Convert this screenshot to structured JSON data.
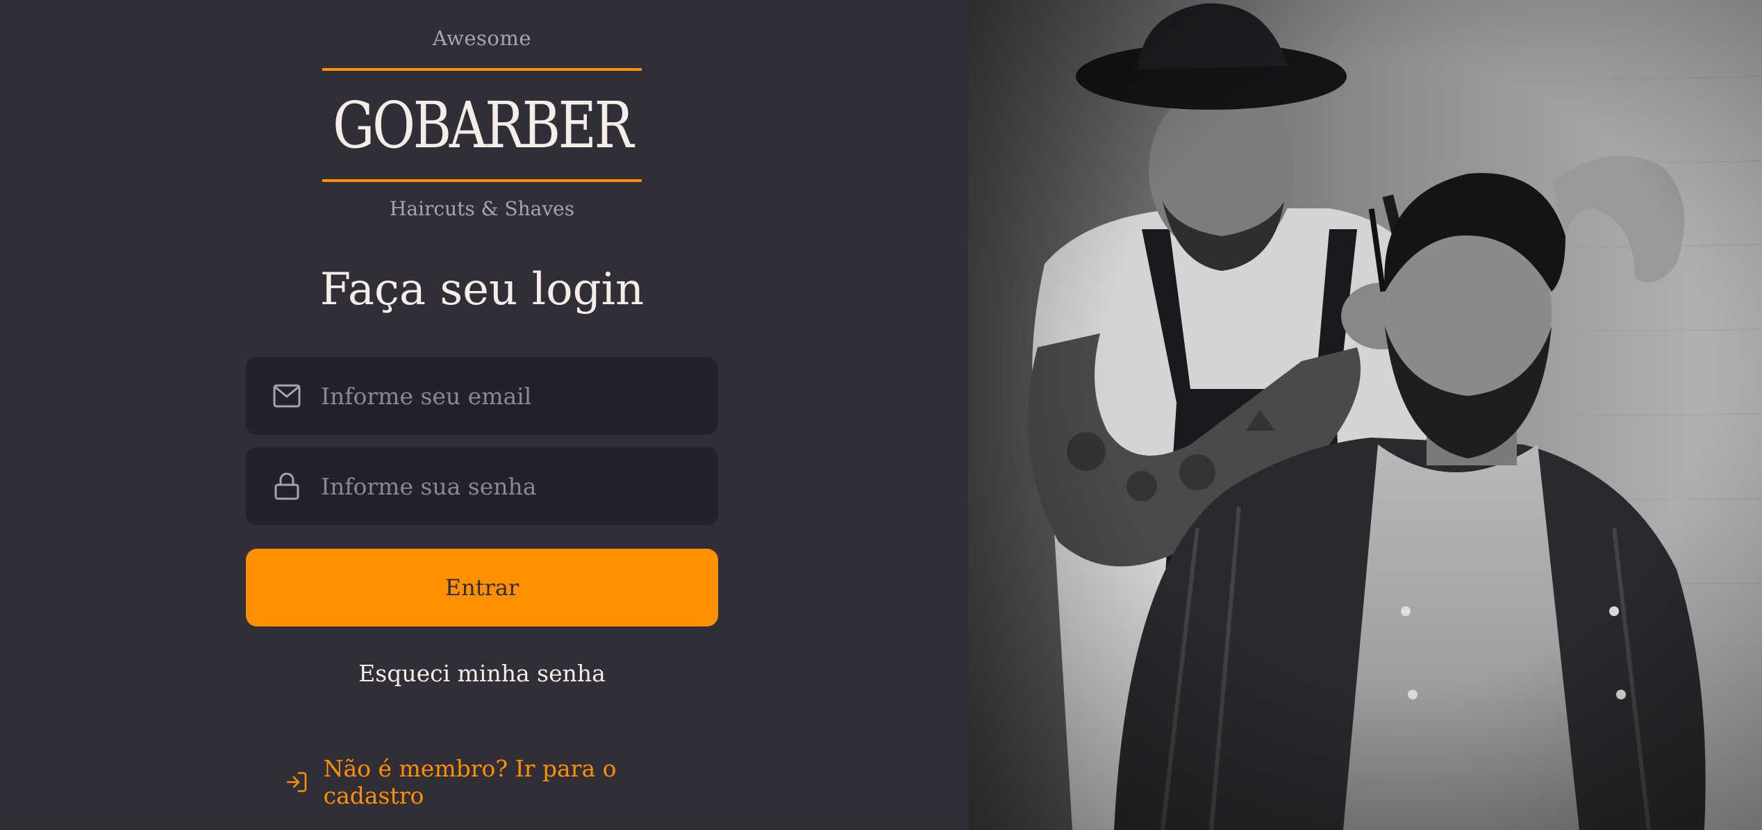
{
  "logo": {
    "top_text": "Awesome",
    "word": "GOBARBER",
    "sub_text": "Haircuts & Shaves"
  },
  "login": {
    "title": "Faça seu login",
    "email_placeholder": "Informe seu email",
    "password_placeholder": "Informe sua senha",
    "submit_label": "Entrar",
    "forgot_label": "Esqueci minha senha",
    "signup_label": "Não é membro? Ir para o cadastro"
  },
  "icons": {
    "email": "mail-icon",
    "password": "lock-icon",
    "signup": "log-in-icon"
  },
  "colors": {
    "background": "#312e38",
    "input_bg": "#232129",
    "accent": "#ff9000",
    "text": "#f4ede8",
    "muted": "#a7a3b0"
  }
}
